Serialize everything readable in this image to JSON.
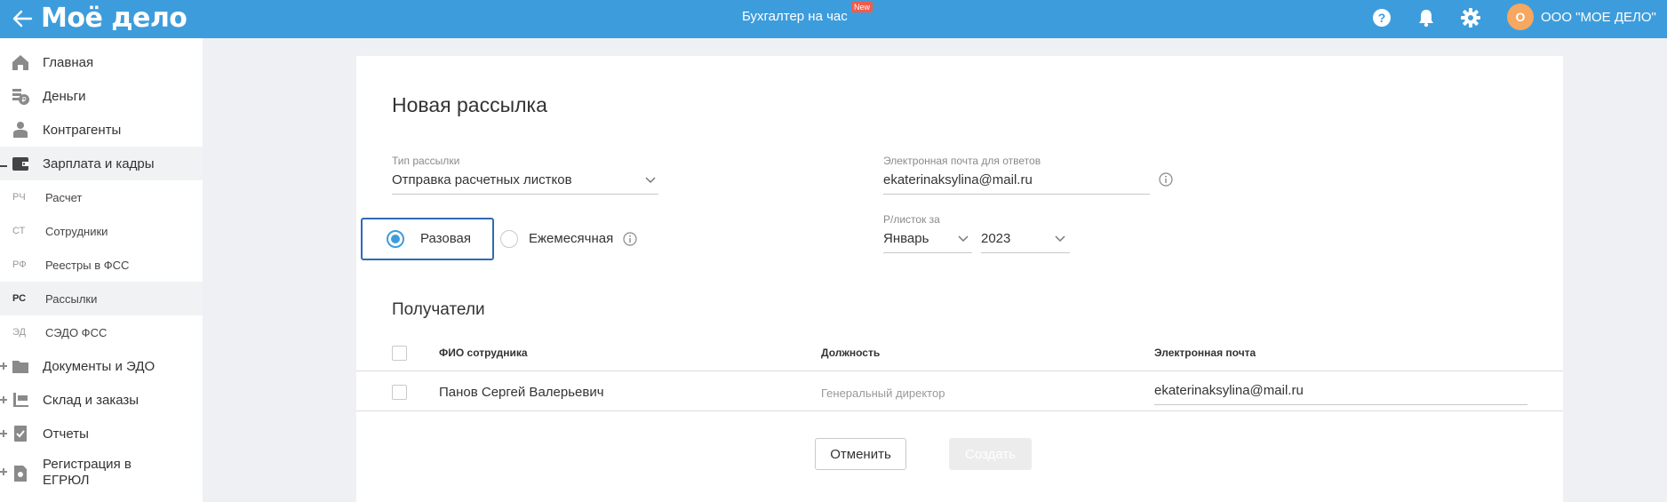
{
  "header": {
    "logo": "Моё дело",
    "center_title": "Бухгалтер на час",
    "new_badge": "New",
    "avatar_letter": "О",
    "org_name": "ООО \"МОЕ ДЕЛО\"",
    "icons": [
      "arrow-left-icon",
      "help-icon",
      "bell-icon",
      "gear-icon"
    ],
    "colors": {
      "bar": "#3d9ddc",
      "badge": "#f25b4b",
      "avatar": "#f6a760"
    }
  },
  "sidebar": {
    "items": [
      {
        "label": "Главная",
        "icon": "home-icon"
      },
      {
        "label": "Деньги",
        "icon": "money-icon"
      },
      {
        "label": "Контрагенты",
        "icon": "contractors-icon"
      },
      {
        "label": "Зарплата и кадры",
        "icon": "wallet-icon"
      },
      {
        "label": "Документы и ЭДО",
        "icon": "folder-icon"
      },
      {
        "label": "Склад и заказы",
        "icon": "warehouse-icon"
      },
      {
        "label": "Отчеты",
        "icon": "report-icon"
      },
      {
        "label": "Регистрация в ЕГРЮЛ",
        "icon": "registration-icon"
      }
    ],
    "subitems": [
      {
        "abbr": "РЧ",
        "label": "Расчет"
      },
      {
        "abbr": "СТ",
        "label": "Сотрудники"
      },
      {
        "abbr": "РФ",
        "label": "Реестры в ФСС"
      },
      {
        "abbr": "РС",
        "label": "Рассылки"
      },
      {
        "abbr": "ЭД",
        "label": "СЭДО ФСС"
      }
    ]
  },
  "form": {
    "title": "Новая рассылка",
    "type_label": "Тип рассылки",
    "type_value": "Отправка расчетных листков",
    "email_label": "Электронная почта для ответов",
    "email_value": "ekaterinaksylina@mail.ru",
    "radio_once": "Разовая",
    "radio_monthly": "Ежемесячная",
    "period_label": "Р/листок за",
    "month_value": "Январь",
    "year_value": "2023"
  },
  "recipients": {
    "title": "Получатели",
    "columns": [
      "ФИО сотрудника",
      "Должность",
      "Электронная почта"
    ],
    "rows": [
      {
        "name": "Панов Сергей Валерьевич",
        "position": "Генеральный директор",
        "email": "ekaterinaksylina@mail.ru"
      }
    ]
  },
  "actions": {
    "cancel": "Отменить",
    "create": "Создать"
  }
}
